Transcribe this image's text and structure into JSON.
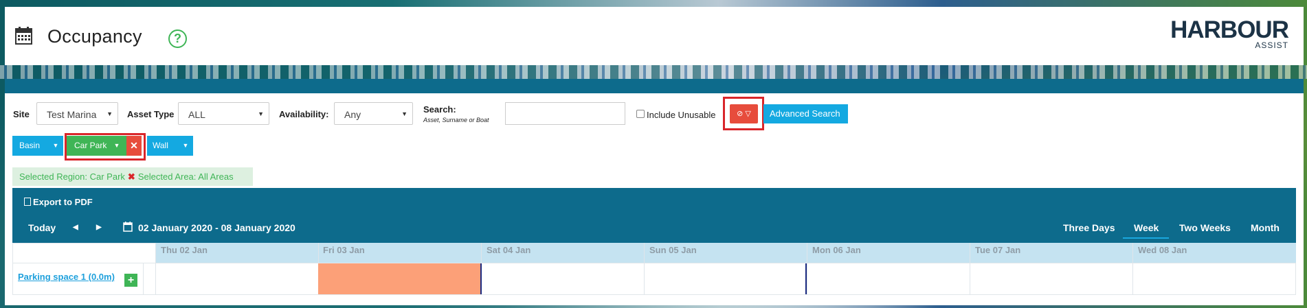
{
  "page": {
    "title": "Occupancy",
    "help_glyph": "?"
  },
  "logo": {
    "main": "HARBOUR",
    "sub": "ASSIST"
  },
  "filters": {
    "site_label": "Site",
    "site_value": "Test Marina",
    "asset_type_label": "Asset Type",
    "asset_type_value": "ALL",
    "availability_label": "Availability:",
    "availability_value": "Any",
    "search_label": "Search:",
    "search_hint": "Asset, Surname or Boat",
    "search_value": "",
    "include_unusable_label": "Include Unusable",
    "include_unusable_checked": false,
    "advanced_search_label": "Advanced Search"
  },
  "regions": [
    {
      "label": "Basin",
      "color": "#14a9e1"
    },
    {
      "label": "Car Park",
      "color": "#3fb556",
      "selected": true
    },
    {
      "label": "Wall",
      "color": "#14a9e1"
    }
  ],
  "selection": {
    "region_text": "Selected Region: Car Park",
    "area_text": "Selected Area: All Areas"
  },
  "calendar": {
    "export_label": "Export to PDF",
    "today_label": "Today",
    "prev_glyph": "◀",
    "next_glyph": "▶",
    "range": "02 January 2020 - 08 January 2020",
    "views": [
      "Three Days",
      "Week",
      "Two Weeks",
      "Month"
    ],
    "active_view": "Week",
    "days": [
      "Thu 02 Jan",
      "Fri 03 Jan",
      "Sat 04 Jan",
      "Sun 05 Jan",
      "Mon 06 Jan",
      "Tue 07 Jan",
      "Wed 08 Jan"
    ],
    "rows": [
      {
        "asset": "Parking space 1 (0.0m)",
        "booking_day": "Fri 03 Jan",
        "booking_color": "#fca078"
      }
    ],
    "add_glyph": "+"
  },
  "colors": {
    "accent": "#14a9e1",
    "header_bar": "#0d6b8c",
    "success": "#3fb556",
    "danger": "#e74c3c"
  }
}
